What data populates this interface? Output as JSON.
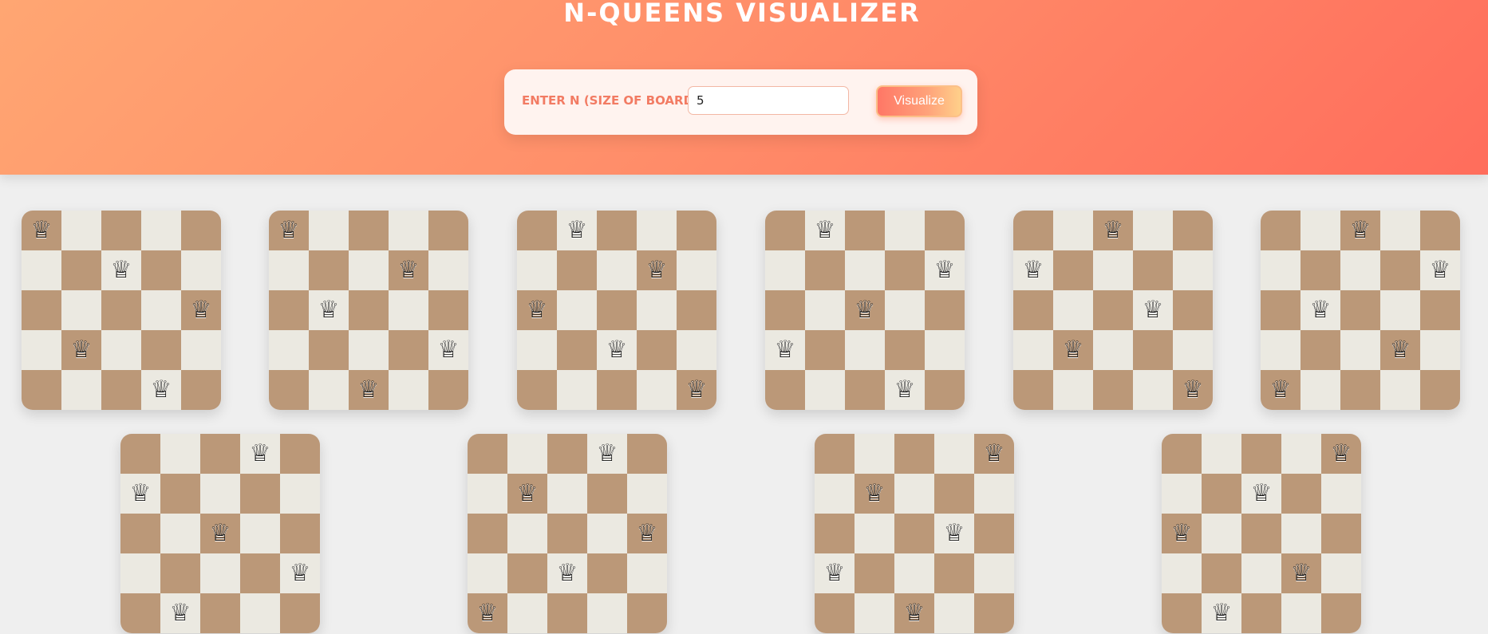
{
  "app": {
    "title": "N-QUEENS VISUALIZER"
  },
  "controls": {
    "label": "ENTER N (SIZE OF BOARD):",
    "input_value": "5",
    "button_label": "Visualize"
  },
  "board_size": 5,
  "queen_icon": "white-queen-icon",
  "colors": {
    "dark_square": "#bb9878",
    "light_square": "#ebe9e1",
    "accent": "#ff7766"
  },
  "solutions": [
    [
      0,
      2,
      4,
      1,
      3
    ],
    [
      0,
      3,
      1,
      4,
      2
    ],
    [
      1,
      3,
      0,
      2,
      4
    ],
    [
      1,
      4,
      2,
      0,
      3
    ],
    [
      2,
      0,
      3,
      1,
      4
    ],
    [
      2,
      4,
      1,
      3,
      0
    ],
    [
      3,
      0,
      2,
      4,
      1
    ],
    [
      3,
      1,
      4,
      2,
      0
    ],
    [
      4,
      1,
      3,
      0,
      2
    ],
    [
      4,
      2,
      0,
      3,
      1
    ]
  ]
}
